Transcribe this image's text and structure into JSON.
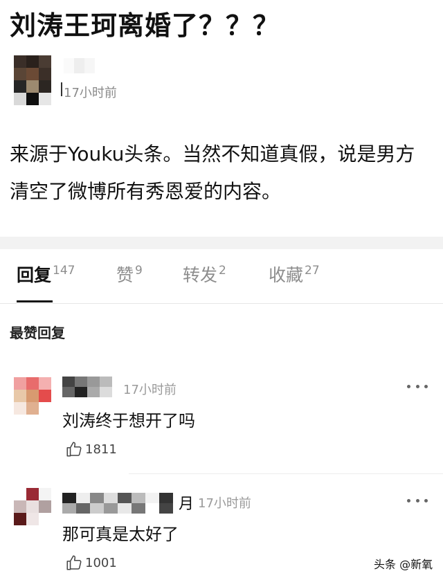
{
  "post": {
    "title": "刘涛王珂离婚了？？？",
    "time": "17小时前",
    "body": "来源于Youku头条。当然不知道真假，说是男方清空了微博所有秀恩爱的内容。"
  },
  "tabs": [
    {
      "label": "回复",
      "count": "147",
      "active": true
    },
    {
      "label": "赞",
      "count": "9",
      "active": false
    },
    {
      "label": "转发",
      "count": "2",
      "active": false
    },
    {
      "label": "收藏",
      "count": "27",
      "active": false
    }
  ],
  "comments_section": {
    "label": "最赞回复",
    "comments": [
      {
        "time": "17小时前",
        "text": "刘涛终于想开了吗",
        "likes": "1811"
      },
      {
        "name_tail": "月",
        "time": "17小时前",
        "text": "那可真是太好了",
        "likes": "1001"
      }
    ]
  },
  "watermark": "头条 @新氧",
  "colors": {
    "text": "#111111",
    "muted": "#8d8d8d",
    "divider": "#f2f2f2"
  },
  "icons": {
    "like": "thumbs-up-icon",
    "more": "more-dots-icon"
  }
}
